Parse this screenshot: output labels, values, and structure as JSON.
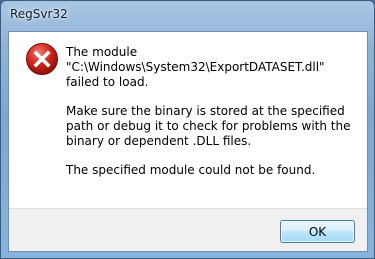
{
  "window": {
    "title": "RegSvr32"
  },
  "message": {
    "line1": "The module\n\"C:\\Windows\\System32\\ExportDATASET.dll\" failed to load.",
    "line2": "Make sure the binary is stored at the specified path or debug it to check for problems with the binary or dependent .DLL files.",
    "line3": "The specified module could not be found."
  },
  "buttons": {
    "ok_label": "OK"
  },
  "icon": {
    "name": "error-icon",
    "color": "#d0251c"
  }
}
